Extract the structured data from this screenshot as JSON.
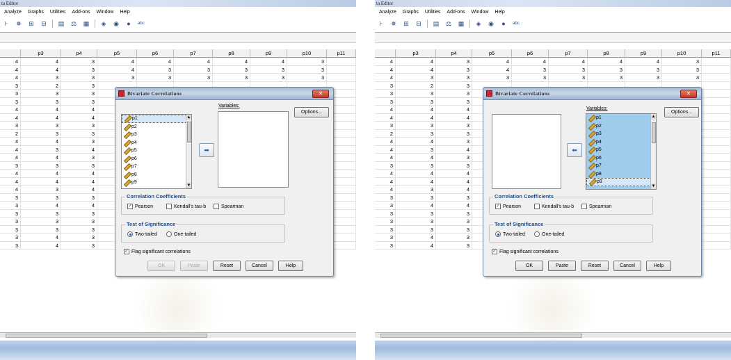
{
  "window": {
    "title": "ta Editor"
  },
  "menu": [
    "Analyze",
    "Graphs",
    "Utilities",
    "Add-ons",
    "Window",
    "Help"
  ],
  "toolbar_icons": [
    "find-icon",
    "binoculars-icon",
    "insert-cases-icon",
    "insert-variable-icon",
    "split-file-icon",
    "weight-cases-icon",
    "select-cases-icon",
    "value-labels-icon",
    "use-sets-icon",
    "show-all-icon",
    "spell-icon"
  ],
  "grid": {
    "columns": [
      "",
      "p3",
      "p4",
      "p5",
      "p6",
      "p7",
      "p8",
      "p9",
      "p10",
      "p11"
    ],
    "rows": [
      [
        "4",
        "4",
        "3",
        "4",
        "4",
        "4",
        "4",
        "4",
        "3",
        ""
      ],
      [
        "4",
        "4",
        "3",
        "4",
        "3",
        "3",
        "3",
        "3",
        "3",
        ""
      ],
      [
        "4",
        "3",
        "3",
        "3",
        "3",
        "3",
        "3",
        "3",
        "3",
        ""
      ],
      [
        "3",
        "2",
        "3",
        "",
        "",
        "",
        "",
        "",
        "",
        ""
      ],
      [
        "3",
        "3",
        "3",
        "",
        "",
        "",
        "",
        "",
        "",
        ""
      ],
      [
        "3",
        "3",
        "3",
        "",
        "",
        "",
        "",
        "",
        "",
        ""
      ],
      [
        "4",
        "4",
        "4",
        "",
        "",
        "",
        "",
        "",
        "",
        ""
      ],
      [
        "4",
        "4",
        "4",
        "",
        "",
        "",
        "",
        "",
        "",
        ""
      ],
      [
        "3",
        "3",
        "3",
        "",
        "",
        "",
        "",
        "",
        "",
        ""
      ],
      [
        "2",
        "3",
        "3",
        "",
        "",
        "",
        "",
        "",
        "",
        ""
      ],
      [
        "4",
        "4",
        "3",
        "",
        "",
        "",
        "",
        "",
        "",
        ""
      ],
      [
        "4",
        "3",
        "4",
        "",
        "",
        "",
        "",
        "",
        "",
        ""
      ],
      [
        "4",
        "4",
        "3",
        "",
        "",
        "",
        "",
        "",
        "",
        ""
      ],
      [
        "3",
        "3",
        "3",
        "",
        "",
        "",
        "",
        "",
        "",
        ""
      ],
      [
        "4",
        "4",
        "4",
        "",
        "",
        "",
        "",
        "",
        "",
        ""
      ],
      [
        "4",
        "4",
        "4",
        "",
        "",
        "",
        "",
        "",
        "",
        ""
      ],
      [
        "4",
        "3",
        "4",
        "",
        "",
        "",
        "",
        "",
        "",
        ""
      ],
      [
        "3",
        "3",
        "3",
        "",
        "",
        "",
        "",
        "",
        "",
        ""
      ],
      [
        "3",
        "4",
        "4",
        "",
        "",
        "",
        "",
        "",
        "",
        ""
      ],
      [
        "3",
        "3",
        "3",
        "3",
        "3",
        "3",
        "2",
        "3",
        "3",
        ""
      ],
      [
        "3",
        "3",
        "3",
        "3",
        "3",
        "3",
        "3",
        "2",
        "3",
        ""
      ],
      [
        "3",
        "3",
        "3",
        "3",
        "3",
        "2",
        "3",
        "2",
        "1",
        ""
      ],
      [
        "3",
        "4",
        "3",
        "3",
        "3",
        "3",
        "3",
        "3",
        "4",
        ""
      ],
      [
        "3",
        "4",
        "3",
        "3",
        "3",
        "3",
        "4",
        "2",
        "3",
        ""
      ]
    ]
  },
  "dialog": {
    "title": "Bivariate Correlations",
    "variables_label": "Variables:",
    "variables": [
      "p1",
      "p2",
      "p3",
      "p4",
      "p5",
      "p6",
      "p7",
      "p8",
      "p9"
    ],
    "options_label": "Options...",
    "corr_title": "Correlation Coefficients",
    "pearson": "Pearson",
    "kendall": "Kendall's tau-b",
    "spearman": "Spearman",
    "sig_title": "Test of Significance",
    "two_tailed": "Two-tailed",
    "one_tailed": "One-tailed",
    "flag": "Flag significant correlations",
    "ok": "OK",
    "paste": "Paste",
    "reset": "Reset",
    "cancel": "Cancel",
    "help": "Help"
  },
  "colors": {
    "accent": "#1f4f8f",
    "selection": "#9fcbec",
    "statusbar": "#9fbbdd"
  }
}
